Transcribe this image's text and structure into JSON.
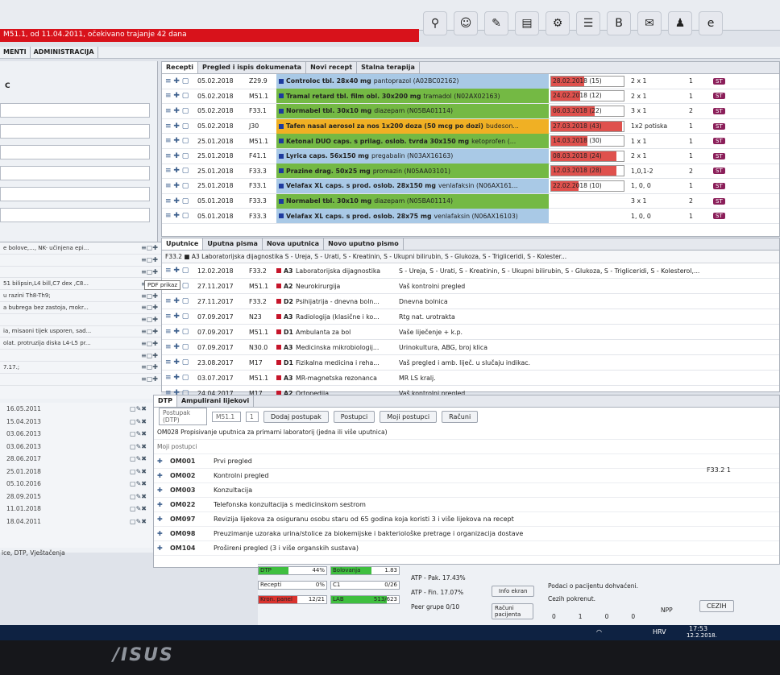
{
  "header": {
    "alert_text": "M51.1, od 11.04.2011, očekivano trajanje 42 dana",
    "menu": [
      "MENTI",
      "ADMINISTRACIJA"
    ],
    "toolbar_icons": [
      "search-person-icon",
      "users-icon",
      "pen-icon",
      "document-icon",
      "user-settings-icon",
      "list-icon",
      "b-plus-icon",
      "notes-icon",
      "person-icon",
      "e-icon"
    ]
  },
  "recepti": {
    "tabs": [
      "Recepti",
      "Pregled i ispis dokumenata",
      "Novi recept",
      "Stalna terapija"
    ],
    "rows": [
      {
        "date": "05.02.2018",
        "code": "Z29.9",
        "drug": "Controloc tbl. 28x40 mg",
        "generic": "pantoprazol (A02BC02162)",
        "color": "#a9c9e6",
        "expiry": "28.02.2018 (15)",
        "fill": 0.45,
        "dose": "2 x 1",
        "count": "1"
      },
      {
        "date": "05.02.2018",
        "code": "M51.1",
        "drug": "Tramal retard tbl. film obl. 30x200 mg",
        "generic": "tramadol (N02AX02163)",
        "color": "#74b944",
        "expiry": "24.02.2018 (12)",
        "fill": 0.4,
        "dose": "2 x 1",
        "count": "1"
      },
      {
        "date": "05.02.2018",
        "code": "F33.1",
        "drug": "Normabel tbl. 30x10 mg",
        "generic": "diazepam (N05BA01114)",
        "color": "#74b944",
        "expiry": "06.03.2018 (22)",
        "fill": 0.6,
        "dose": "3 x 1",
        "count": "2"
      },
      {
        "date": "05.02.2018",
        "code": "J30",
        "drug": "Tafen nasal aerosol za nos 1x200 doza (50 mcg po dozi)",
        "generic": "budeson...",
        "color": "#f0b024",
        "expiry": "27.03.2018 (43)",
        "fill": 0.98,
        "dose": "1x2 potiska",
        "count": "1"
      },
      {
        "date": "25.01.2018",
        "code": "M51.1",
        "drug": "Ketonal DUO caps. s prilag. oslob. tvrda 30x150 mg",
        "generic": "ketoprofen (...",
        "color": "#74b944",
        "expiry": "14.03.2018 (30)",
        "fill": 0.5,
        "dose": "1 x 1",
        "count": "1"
      },
      {
        "date": "25.01.2018",
        "code": "F41.1",
        "drug": "Lyrica caps. 56x150 mg",
        "generic": "pregabalin (N03AX16163)",
        "color": "#a9c9e6",
        "expiry": "08.03.2018 (24)",
        "fill": 0.9,
        "dose": "2 x 1",
        "count": "1"
      },
      {
        "date": "25.01.2018",
        "code": "F33.3",
        "drug": "Prazine drag. 50x25 mg",
        "generic": "promazin (N05AA03101)",
        "color": "#74b944",
        "expiry": "12.03.2018 (28)",
        "fill": 0.9,
        "dose": "1,0,1-2",
        "count": "2"
      },
      {
        "date": "25.01.2018",
        "code": "F33.1",
        "drug": "Velafax XL caps. s prod. oslob. 28x150 mg",
        "generic": "venlafaksin (N06AX161...",
        "color": "#a9c9e6",
        "expiry": "22.02.2018 (10)",
        "fill": 0.38,
        "dose": "1, 0, 0",
        "count": "1"
      },
      {
        "date": "05.01.2018",
        "code": "F33.3",
        "drug": "Normabel tbl. 30x10 mg",
        "generic": "diazepam (N05BA01114)",
        "color": "#74b944",
        "expiry": "",
        "fill": 0,
        "dose": "3 x 1",
        "count": "2"
      },
      {
        "date": "05.01.2018",
        "code": "F33.3",
        "drug": "Velafax XL caps. s prod. oslob. 28x75 mg",
        "generic": "venlafaksin (N06AX16103)",
        "color": "#a9c9e6",
        "expiry": "",
        "fill": 0,
        "dose": "1, 0, 0",
        "count": "1"
      }
    ],
    "st_label": "ST"
  },
  "uputnice": {
    "tabs": [
      "Uputnice",
      "Uputna pisma",
      "Nova uputnica",
      "Novo uputno pismo"
    ],
    "summary": "F33.2  ■ A3  Laboratorijska dijagnostika  S - Ureja, S - Urati, S - Kreatinin, S - Ukupni bilirubin, S - Glukoza, S - Trigliceridi, S - Kolester...",
    "tooltip": "PDF prikaz",
    "rows": [
      {
        "date": "12.02.2018",
        "code": "F33.2",
        "kind": "A3",
        "spec": "Laboratorijska dijagnostika",
        "desc": "S - Ureja, S - Urati, S - Kreatinin, S - Ukupni bilirubin, S - Glukoza, S - Trigliceridi, S - Kolesterol,..."
      },
      {
        "date": "27.11.2017",
        "code": "M51.1",
        "kind": "A2",
        "spec": "Neurokirurgija",
        "desc": "Vaš kontrolni pregled"
      },
      {
        "date": "27.11.2017",
        "code": "F33.2",
        "kind": "D2",
        "spec": "Psihijatrija - dnevna boln...",
        "desc": "Dnevna bolnica"
      },
      {
        "date": "07.09.2017",
        "code": "N23",
        "kind": "A3",
        "spec": "Radiologija (klasične i ko...",
        "desc": "Rtg nat. urotrakta"
      },
      {
        "date": "07.09.2017",
        "code": "M51.1",
        "kind": "D1",
        "spec": "Ambulanta za bol",
        "desc": "Vaše liječenje + k.p."
      },
      {
        "date": "07.09.2017",
        "code": "N30.0",
        "kind": "A3",
        "spec": "Medicinska mikrobiologij...",
        "desc": "Urinokultura, ABG, broj klica"
      },
      {
        "date": "23.08.2017",
        "code": "M17",
        "kind": "D1",
        "spec": "Fizikalna medicina i reha...",
        "desc": "Vaš pregled i amb. liječ. u slučaju indikac."
      },
      {
        "date": "03.07.2017",
        "code": "M51.1",
        "kind": "A3",
        "spec": "MR-magnetska rezonanca",
        "desc": "MR LS kralj."
      },
      {
        "date": "24.04.2017",
        "code": "M17",
        "kind": "A2",
        "spec": "Ortopedija",
        "desc": "Vaš kontrolni pregled"
      }
    ]
  },
  "left": {
    "header_letter": "C",
    "middle_rows": [
      "e bolove,..., NK- učinjena epi...",
      "",
      "",
      "51 bilipsin,L4 bill,C7 dex ,C8...",
      "u razini Th8-Th9;",
      "a bubrega bez zastoja, mokr...",
      "",
      "ia, misaoni tijek usporen, sad...",
      "olat. protruzija diska L4-L5 pr...",
      "",
      "7.17.;",
      ""
    ],
    "dates": [
      "16.05.2011",
      "15.04.2013",
      "03.06.2013",
      "03.06.2013",
      "28.06.2017",
      "25.01.2018",
      "05.10.2016",
      "28.09.2015",
      "11.01.2018",
      "18.04.2011"
    ],
    "footer": "ice, DTP, Vještačenja"
  },
  "dtp": {
    "tabs": [
      "DTP",
      "Ampulirani lijekovi"
    ],
    "postupak_placeholder": "Postupak (DTP)",
    "dx": "M51.1",
    "qty": "1",
    "buttons": [
      "Dodaj postupak",
      "Postupci",
      "Moji postupci",
      "Računi"
    ],
    "om028": "OM028  Propisivanje uputnica za primarni laboratorij (jedna ili više uputnica)",
    "moji_label": "Moji postupci",
    "items": [
      {
        "code": "OM001",
        "label": "Prvi pregled"
      },
      {
        "code": "OM002",
        "label": "Kontrolni pregled"
      },
      {
        "code": "OM003",
        "label": "Konzultacija"
      },
      {
        "code": "OM022",
        "label": "Telefonska konzultacija s medicinskom sestrom"
      },
      {
        "code": "OM097",
        "label": "Revizija lijekova za osiguranu osobu staru od 65 godina koja koristi 3 i više lijekova na recept"
      },
      {
        "code": "OM098",
        "label": "Preuzimanje uzoraka urina/stolice za biokemijske i bakteriološke pretrage i organizacija dostave"
      },
      {
        "code": "OM104",
        "label": "Prošireni pregled (3 i više organskih sustava)"
      }
    ],
    "right_tag": "F33.2  1"
  },
  "status": {
    "bars": [
      {
        "label": "DTP",
        "value": "44%",
        "fill": 0.44
      },
      {
        "label": "Bolovanja",
        "value": "1.83",
        "fill": 0.6
      },
      {
        "label": "Recepti",
        "value": "0%",
        "fill": 0
      },
      {
        "label": "C1",
        "value": "0/26",
        "fill": 0
      },
      {
        "label": "Kron. panel",
        "value": "12/21",
        "fill": 0.57
      },
      {
        "label": "LAB",
        "value": "513/623",
        "fill": 0.82
      }
    ],
    "atp_pak": "ATP - Pak.  17.43%",
    "atp_fin": "ATP - Fin.  17.07%",
    "peer": "Peer grupe  0/10",
    "info": "Info ekran",
    "racuni": "Računi pacijenta",
    "msg1": "Podaci o pacijentu dohvaćeni.",
    "msg2": "Cezih pokrenut.",
    "npp": "NPP",
    "counts": [
      "0",
      "1",
      "0",
      "0"
    ],
    "cezih": "CEZIH"
  },
  "taskbar": {
    "lang": "HRV",
    "time": "17:53",
    "date": "12.2.2018."
  },
  "bezel_logo": "/ISUS"
}
